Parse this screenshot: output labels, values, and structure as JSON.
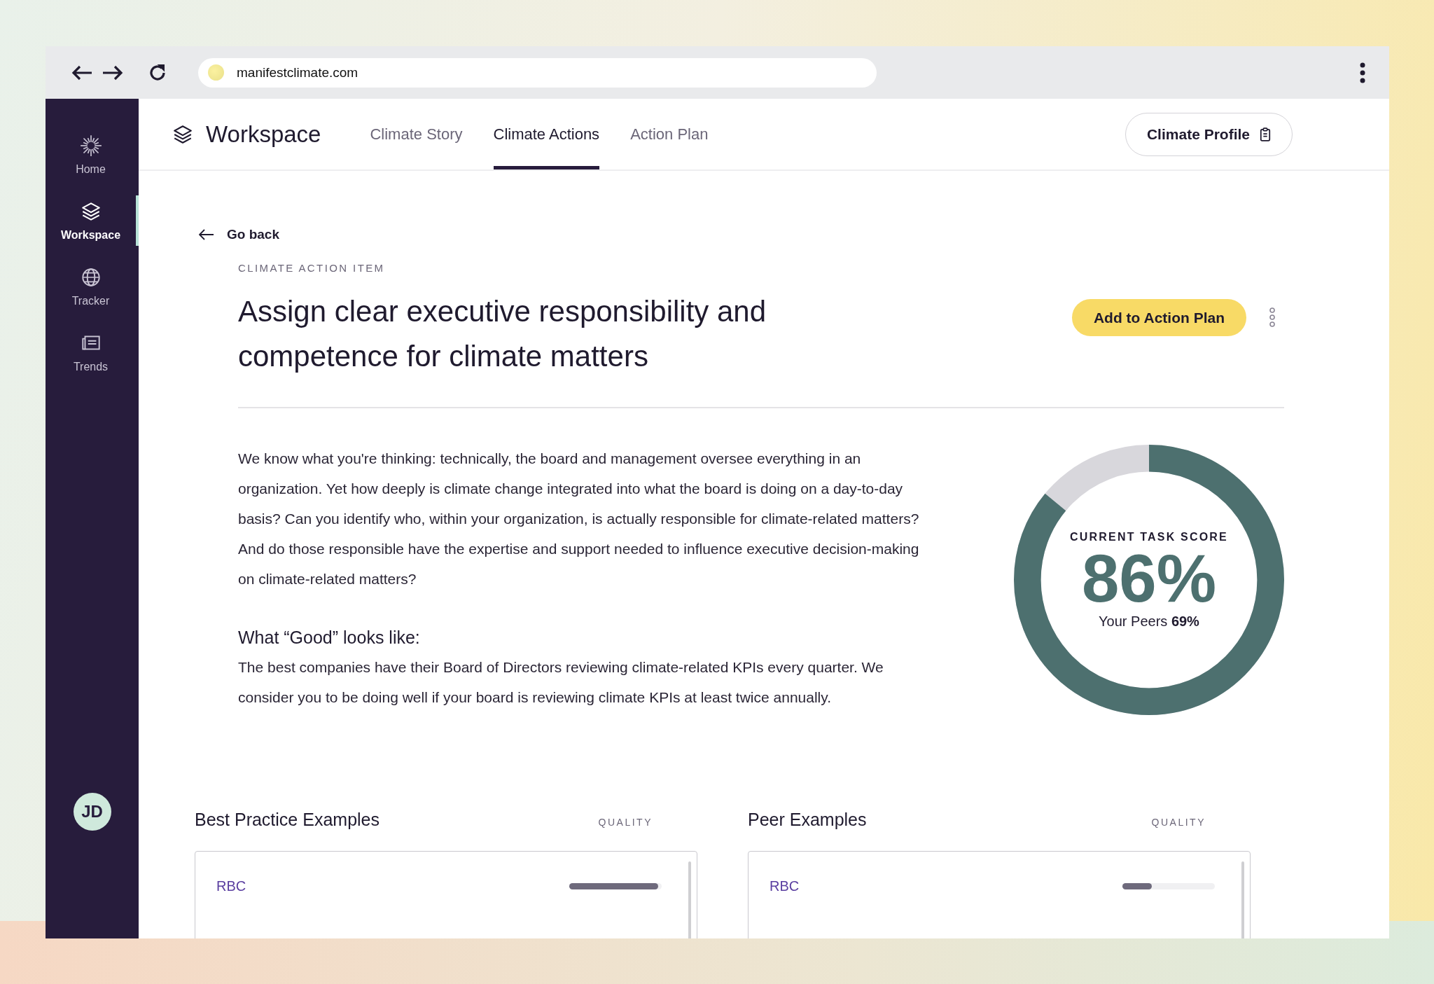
{
  "browser": {
    "url": "manifestclimate.com"
  },
  "sidebar": {
    "items": [
      {
        "label": "Home",
        "selected": false
      },
      {
        "label": "Workspace",
        "selected": true
      },
      {
        "label": "Tracker",
        "selected": false
      },
      {
        "label": "Trends",
        "selected": false
      }
    ],
    "avatar": "JD"
  },
  "header": {
    "title": "Workspace",
    "tabs": [
      {
        "label": "Climate Story",
        "selected": false
      },
      {
        "label": "Climate Actions",
        "selected": true
      },
      {
        "label": "Action Plan",
        "selected": false
      }
    ],
    "profile_button": "Climate Profile"
  },
  "back_link": "Go back",
  "eyebrow": "CLIMATE ACTION ITEM",
  "title": "Assign clear executive responsibility and competence for climate matters",
  "primary_button": "Add to Action Plan",
  "description": "We know what you're thinking: technically, the board and management oversee everything in an organization. Yet how deeply is climate change integrated into what the board is doing on a day-to-day basis? Can you identify who, within your organization, is actually responsible for climate-related matters? And do those responsible have the expertise and support needed to influence executive decision-making on climate-related matters?",
  "good": {
    "heading": "What “Good” looks like:",
    "text": "The best companies have their Board of Directors reviewing climate-related KPIs every quarter. We consider you to be doing well if your board is reviewing climate KPIs at least twice annually."
  },
  "score": {
    "label": "CURRENT TASK SCORE",
    "value": "86%",
    "level": 0.86,
    "peers_label": "Your Peers",
    "peers_value": "69%"
  },
  "examples": [
    {
      "title": "Best Practice Examples",
      "quality_label": "QUALITY",
      "rows": [
        {
          "name": "RBC",
          "level": 0.96
        }
      ]
    },
    {
      "title": "Peer Examples",
      "quality_label": "QUALITY",
      "rows": [
        {
          "name": "RBC",
          "level": 0.32
        }
      ]
    }
  ]
}
